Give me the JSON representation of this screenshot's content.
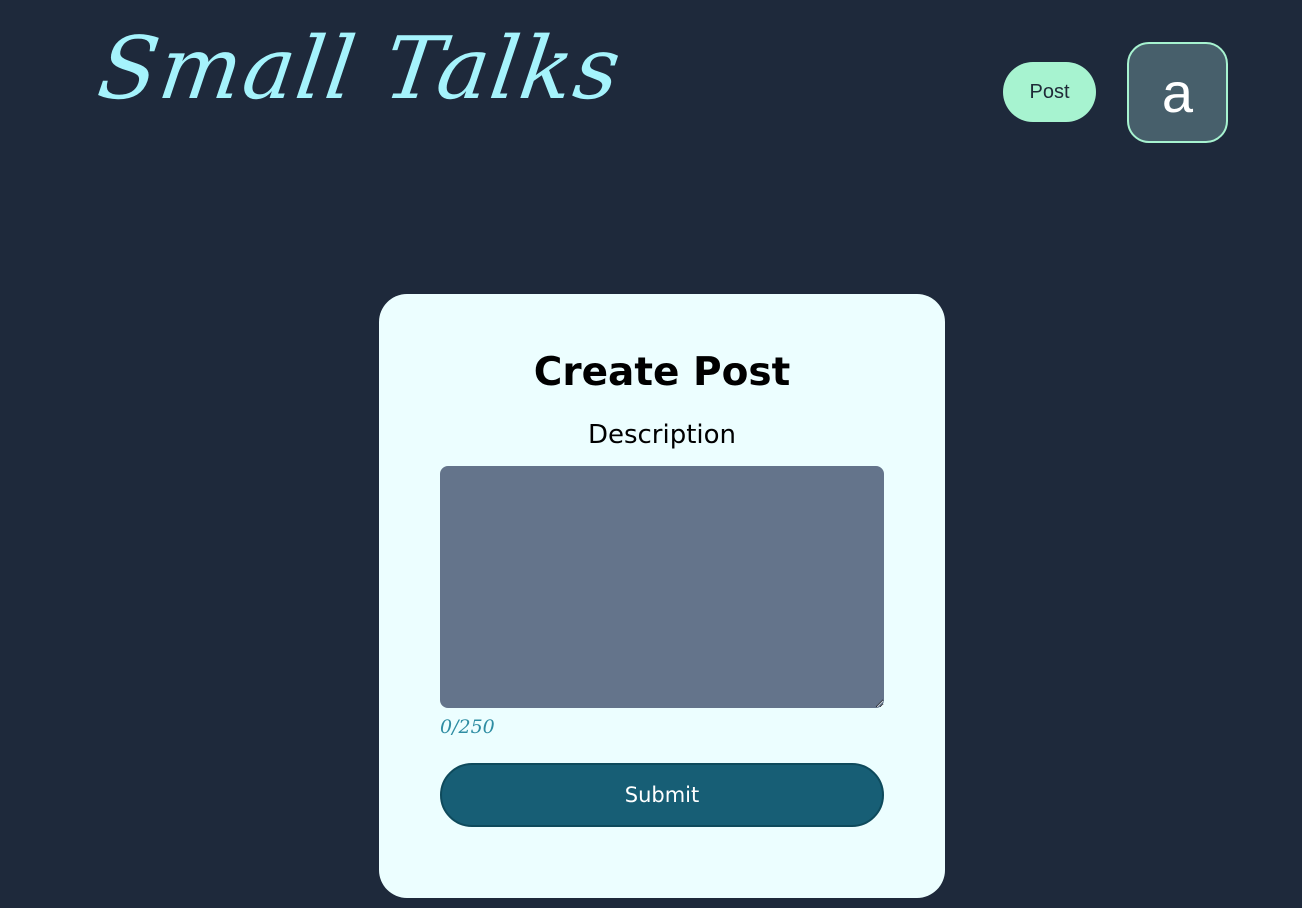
{
  "header": {
    "logo_text": "Small Talks",
    "post_button_label": "Post",
    "avatar_letter": "a"
  },
  "form": {
    "title": "Create Post",
    "description_label": "Description",
    "description_value": "",
    "char_counter": "0/250",
    "submit_label": "Submit"
  },
  "colors": {
    "background": "#1e293b",
    "logo": "#a5f3fc",
    "post_button": "#a7f3d0",
    "avatar_bg": "#475f6b",
    "card_bg": "#ecfeff",
    "textarea_bg": "#64748b",
    "counter": "#2e8da3",
    "submit_bg": "#175e75"
  }
}
